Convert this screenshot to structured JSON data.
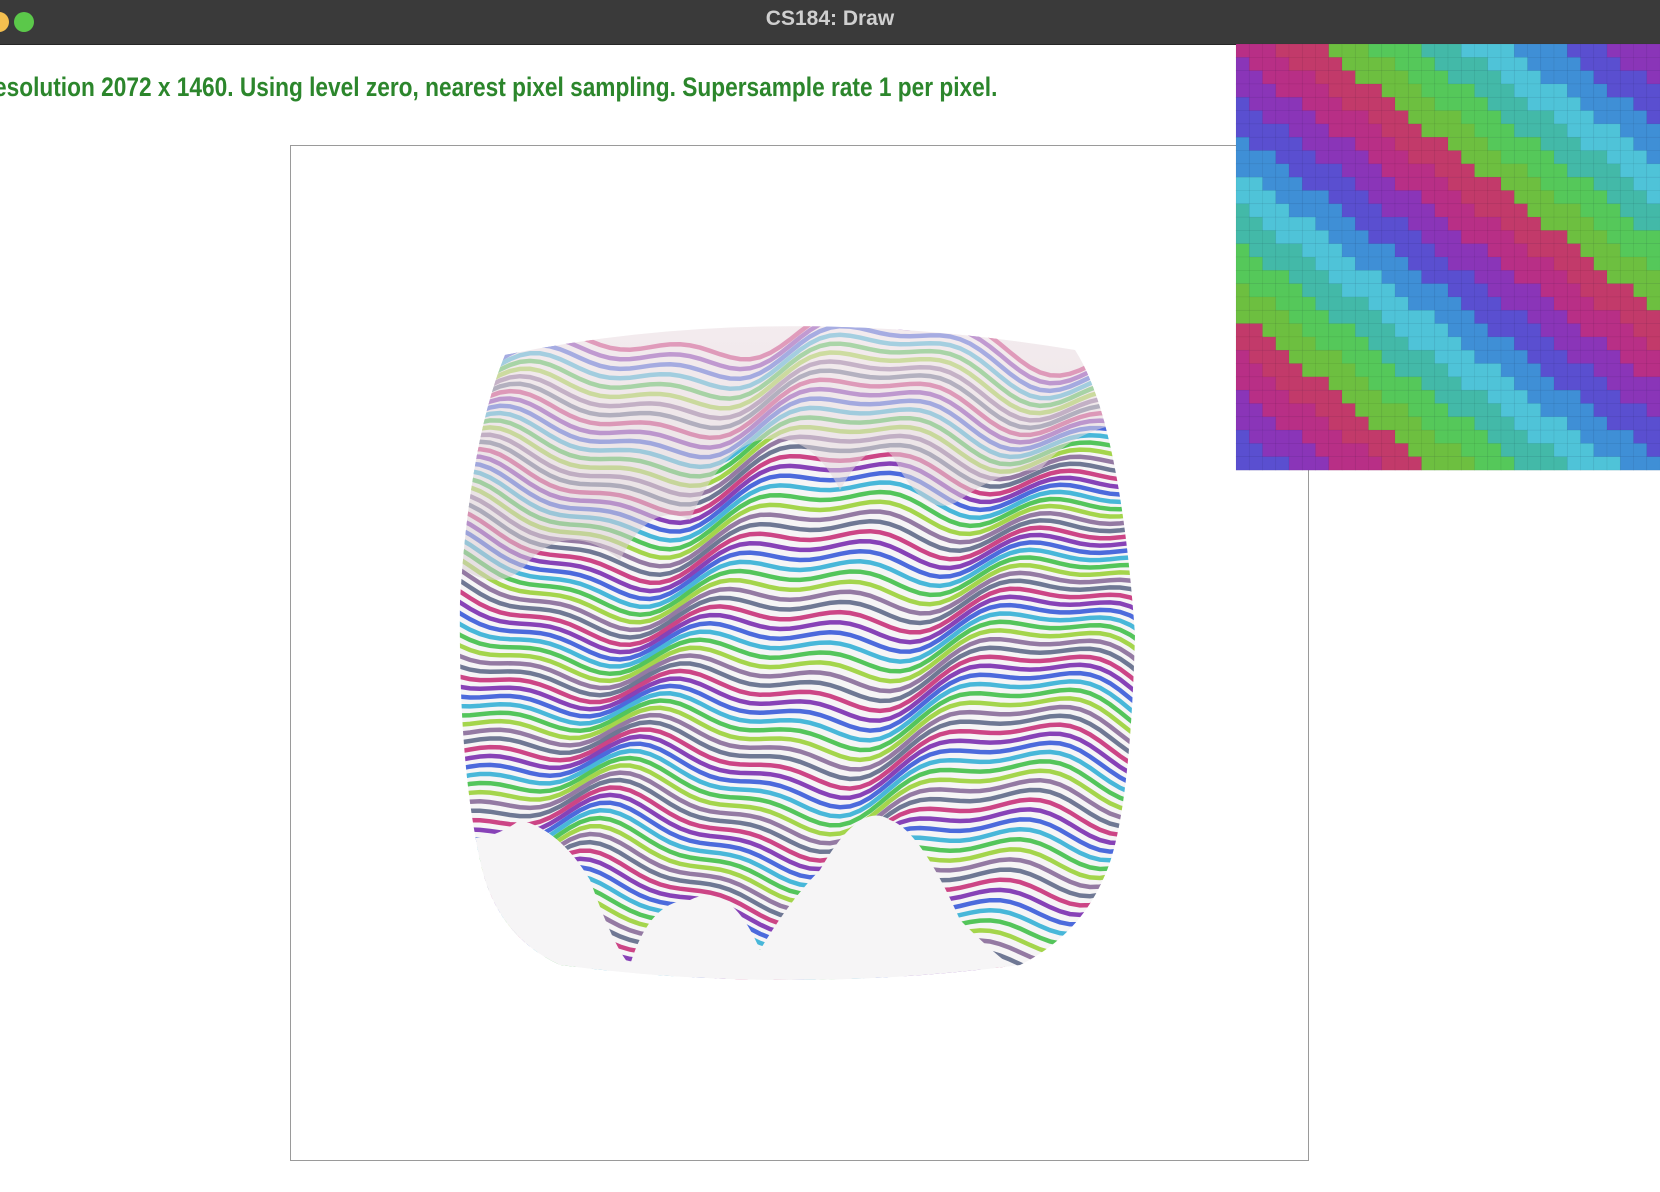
{
  "window": {
    "title": "CS184: Draw",
    "controls": [
      "close-button",
      "minimize-button",
      "maximize-button"
    ]
  },
  "status": {
    "text": "esolution 2072 x 1460. Using level zero, nearest pixel sampling. Supersample rate 1 per pixel."
  },
  "canvas": {
    "description_shape": "warped-cube-face"
  },
  "zoom_view": {
    "grid_cells": 32
  },
  "colors": {
    "titlebar": "#3a3a3a",
    "status_text": "#2c862c",
    "traffic_green": "#5bc84a",
    "traffic_yellow": "#f4bf4f",
    "canvas_border": "#9a9a9a"
  }
}
